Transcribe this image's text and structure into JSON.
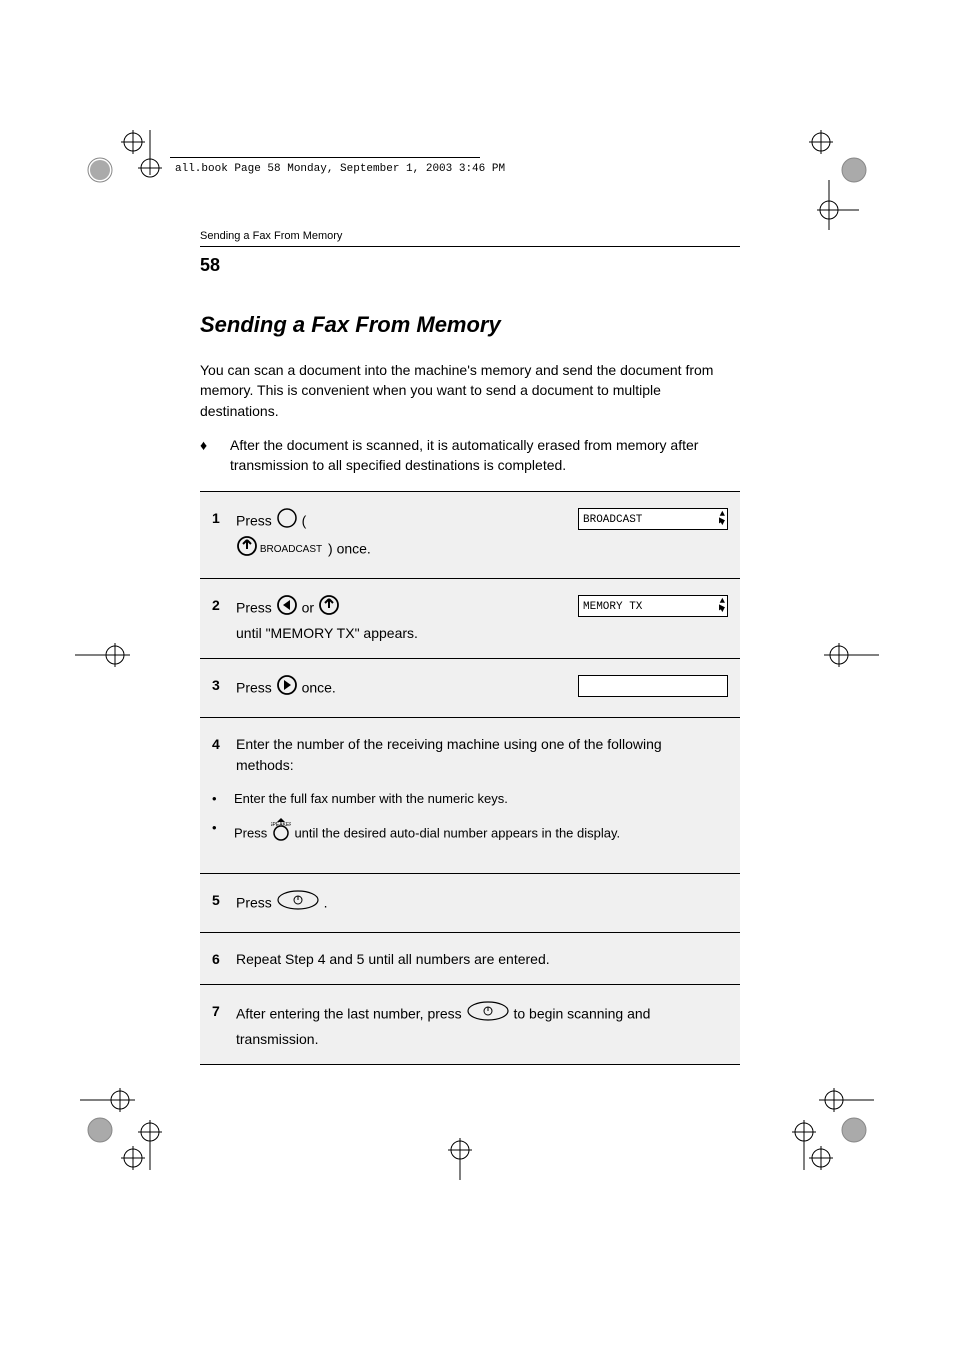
{
  "print_header": "all.book  Page 58  Monday, September 1, 2003  3:46 PM",
  "section_label": "Sending a Fax From Memory",
  "page_number": "58",
  "heading": "Sending a Fax From Memory",
  "intro": "You can scan a document into the machine's memory and send the document from memory. This is convenient when you want to send a document to multiple destinations.",
  "intro_bullet": "After the document is scanned, it is automatically erased from memory after transmission to all specified destinations is completed.",
  "steps": [
    {
      "num": "1",
      "text_a": "Press ",
      "label_a": "BROADCAST",
      "text_b": " (",
      "text_c": ") once.",
      "lcd": "BROADCAST"
    },
    {
      "num": "2",
      "text_a": "Press ",
      "text_b": " or ",
      "text_c": " until \"MEMORY TX\" appears.",
      "lcd": "MEMORY TX"
    },
    {
      "num": "3",
      "text_a": "Press ",
      "text_b": " once.",
      "lcd": ""
    },
    {
      "num": "4",
      "text": "Enter the number of the receiving machine using one of the following methods:"
    }
  ],
  "sub_bullets": [
    "Enter the full fax number with the numeric keys.",
    "Press  until the desired auto-dial number appears in the display."
  ],
  "speaker_label": "SPEAKER",
  "final_steps": [
    {
      "num": "5",
      "text_a": "Press ",
      "text_b": "."
    },
    {
      "num": "6",
      "text": "Repeat Step 4 and 5 until all numbers are entered."
    },
    {
      "num": "7",
      "text_a": "After entering the last number, press ",
      "text_b": " to begin scanning and transmission."
    }
  ],
  "icons": {
    "broadcast": "broadcast-key-icon",
    "up": "up-arrow-icon",
    "left": "left-nav-icon",
    "right": "right-nav-icon",
    "speaker": "speaker-key-icon",
    "start": "start-key-icon"
  }
}
